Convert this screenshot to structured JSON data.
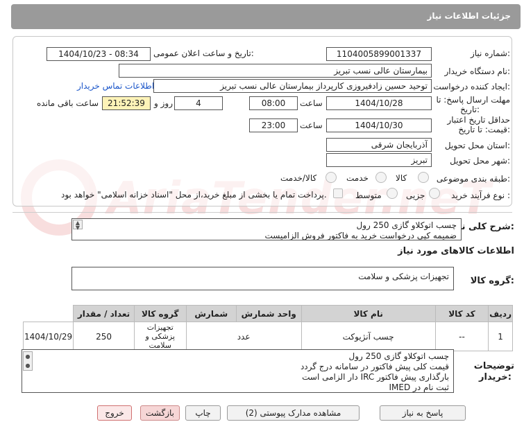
{
  "header": {
    "title": "جزئیات اطلاعات نیاز"
  },
  "watermark": {
    "text": "AriaTender.neT"
  },
  "form": {
    "need_number_label": "شماره نیاز:",
    "need_number": "1104005899001337",
    "announce_label": "تاریخ و ساعت اعلان عمومی:",
    "announce_value": "1404/10/23 - 08:34",
    "buyer_org_label": "نام دستگاه خریدار:",
    "buyer_org": "بیمارستان عالی نسب تبریز",
    "creator_label": "ایجاد کننده درخواست:",
    "creator": "توحید حسین زادفیروزی کارپرداز بیمارستان عالی نسب تبریز",
    "contact_link": "اطلاعات تماس خریدار",
    "reply_deadline_label_1": "مهلت ارسال پاسخ: تا",
    "reply_deadline_label_2": "تاریخ:",
    "reply_date": "1404/10/28",
    "time_label": "ساعت",
    "reply_time": "08:00",
    "days_value": "4",
    "days_label": "روز و",
    "remaining_time": "21:52:39",
    "remaining_label": "ساعت باقی مانده",
    "validity_label_1": "حداقل تاریخ اعتبار",
    "validity_label_2": "قیمت: تا تاریخ:",
    "validity_date": "1404/10/30",
    "validity_time": "23:00",
    "province_label": "استان محل تحویل:",
    "province": "آذربایجان شرقی",
    "city_label": "شهر محل تحویل:",
    "city": "تبریز",
    "category_label": "طبقه بندی موضوعی:",
    "category_options": [
      "کالا",
      "خدمت",
      "کالا/خدمت"
    ],
    "process_label": "نوع فرآیند خرید :",
    "process_options": [
      "جزیی",
      "متوسط"
    ],
    "payment_note": "پرداخت تمام یا بخشی از مبلغ خرید،از محل \"اسناد خزانه اسلامی\" خواهد بود."
  },
  "need_desc": {
    "label": "شرح کلی نیاز:",
    "lines": [
      "چسب اتوکلاو گازی 250 رول",
      "ضمیمه کپی درخواست خرید به فاکتور فروش الزامیست"
    ]
  },
  "goods_info": {
    "title": "اطلاعات کالاهای مورد نیاز",
    "group_label": "گروه کالا:",
    "group_value": "تجهیزات پزشکی و سلامت"
  },
  "table": {
    "headers": [
      "ردیف",
      "کد کالا",
      "نام کالا",
      "واحد شمارش",
      "شمارش",
      "گروه کالا",
      "تعداد / مقدار",
      "تاریخ نیاز"
    ],
    "rows": [
      {
        "row": "1",
        "code": "--",
        "name": "چسب آنژیوکت",
        "unit": "عدد",
        "group": "تجهیزات پزشکی و سلامت",
        "qty": "250",
        "date": "1404/10/29"
      }
    ]
  },
  "buyer_notes": {
    "label_1": "توضیحات",
    "label_2": "خریدار:",
    "lines": [
      "چسب اتوکلاو گازی 250 رول",
      "قیمت کلی پیش فاکتور در سامانه درج گردد",
      "بارگذاری پیش فاکتور IRC دار الزامی است",
      "ثبت نام در IMED"
    ]
  },
  "buttons": {
    "reply": "پاسخ به نیاز",
    "attachments": "مشاهده مدارک پیوستی (2)",
    "print": "چاپ",
    "back": "بازگشت",
    "exit": "خروج"
  }
}
